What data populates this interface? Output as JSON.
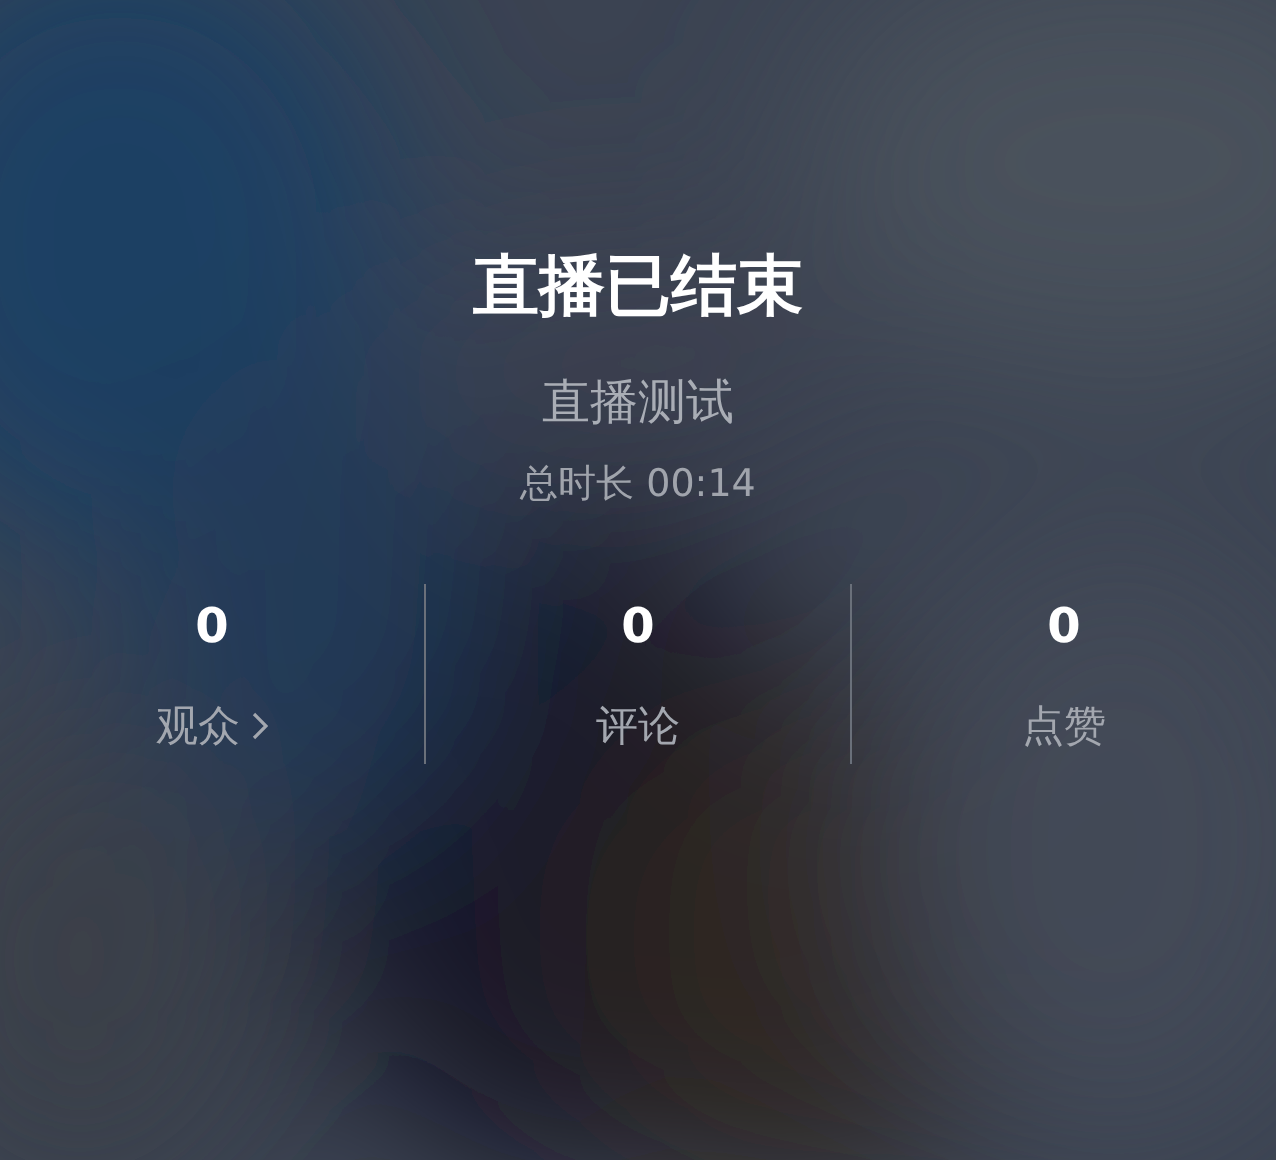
{
  "title": "直播已结束",
  "subtitle": "直播测试",
  "duration": "总时长 00:14",
  "stats": [
    {
      "value": "0",
      "label": "观众",
      "chevron": true
    },
    {
      "value": "0",
      "label": "评论",
      "chevron": false
    },
    {
      "value": "0",
      "label": "点赞",
      "chevron": false
    }
  ]
}
